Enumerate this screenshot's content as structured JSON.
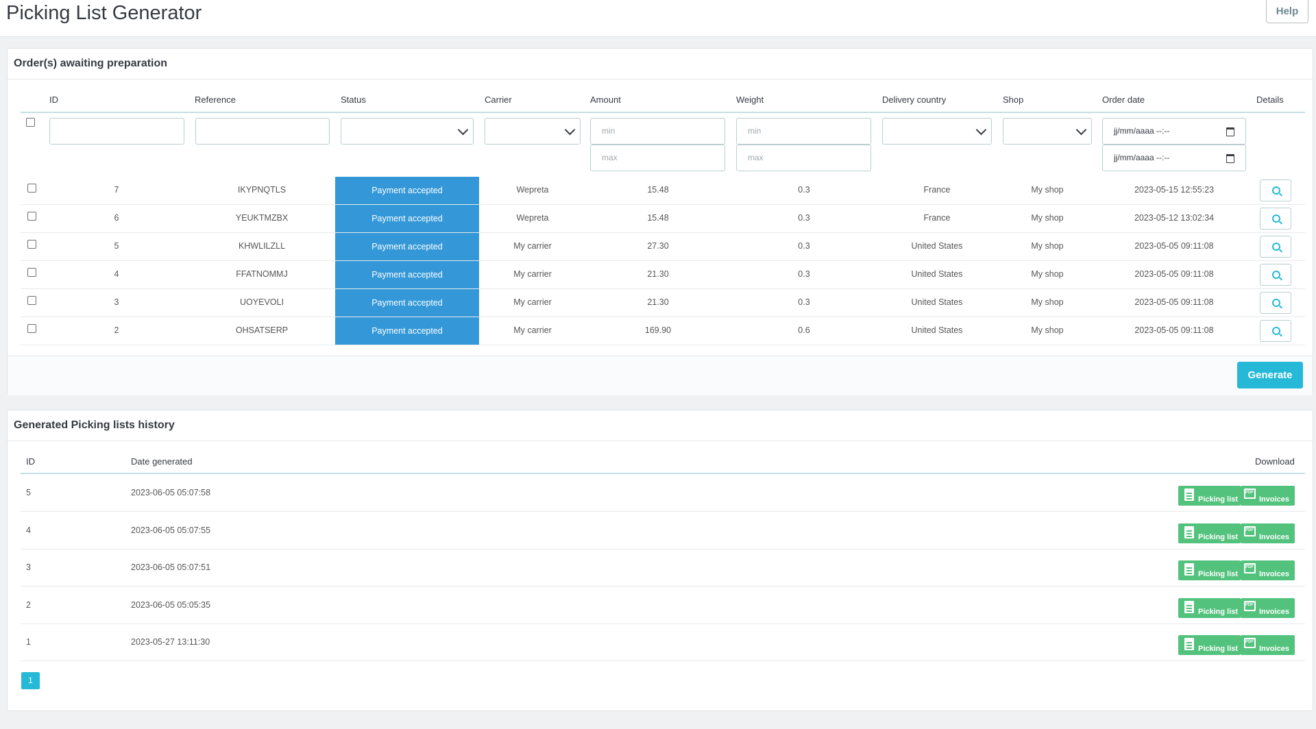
{
  "header": {
    "title": "Picking List Generator",
    "help_label": "Help"
  },
  "orders_panel": {
    "title": "Order(s) awaiting preparation",
    "columns": [
      "ID",
      "Reference",
      "Status",
      "Carrier",
      "Amount",
      "Weight",
      "Delivery country",
      "Shop",
      "Order date",
      "Details"
    ],
    "filters": {
      "amount_min_placeholder": "min",
      "amount_max_placeholder": "max",
      "weight_min_placeholder": "min",
      "weight_max_placeholder": "max",
      "date_from_placeholder": "jj/mm/aaaa --:--",
      "date_to_placeholder": "jj/mm/aaaa --:--"
    },
    "rows": [
      {
        "id": "7",
        "reference": "IKYPNQTLS",
        "status": "Payment accepted",
        "carrier": "Wepreta",
        "amount": "15.48",
        "weight": "0.3",
        "country": "France",
        "shop": "My shop",
        "date": "2023-05-15 12:55:23"
      },
      {
        "id": "6",
        "reference": "YEUKTMZBX",
        "status": "Payment accepted",
        "carrier": "Wepreta",
        "amount": "15.48",
        "weight": "0.3",
        "country": "France",
        "shop": "My shop",
        "date": "2023-05-12 13:02:34"
      },
      {
        "id": "5",
        "reference": "KHWLILZLL",
        "status": "Payment accepted",
        "carrier": "My carrier",
        "amount": "27.30",
        "weight": "0.3",
        "country": "United States",
        "shop": "My shop",
        "date": "2023-05-05 09:11:08"
      },
      {
        "id": "4",
        "reference": "FFATNOMMJ",
        "status": "Payment accepted",
        "carrier": "My carrier",
        "amount": "21.30",
        "weight": "0.3",
        "country": "United States",
        "shop": "My shop",
        "date": "2023-05-05 09:11:08"
      },
      {
        "id": "3",
        "reference": "UOYEVOLI",
        "status": "Payment accepted",
        "carrier": "My carrier",
        "amount": "21.30",
        "weight": "0.3",
        "country": "United States",
        "shop": "My shop",
        "date": "2023-05-05 09:11:08"
      },
      {
        "id": "2",
        "reference": "OHSATSERP",
        "status": "Payment accepted",
        "carrier": "My carrier",
        "amount": "169.90",
        "weight": "0.6",
        "country": "United States",
        "shop": "My shop",
        "date": "2023-05-05 09:11:08"
      }
    ],
    "generate_label": "Generate"
  },
  "history_panel": {
    "title": "Generated Picking lists history",
    "columns": [
      "ID",
      "Date generated",
      "Download"
    ],
    "rows": [
      {
        "id": "5",
        "date": "2023-06-05 05:07:58"
      },
      {
        "id": "4",
        "date": "2023-06-05 05:07:55"
      },
      {
        "id": "3",
        "date": "2023-06-05 05:07:51"
      },
      {
        "id": "2",
        "date": "2023-06-05 05:05:35"
      },
      {
        "id": "1",
        "date": "2023-05-27 13:11:30"
      }
    ],
    "picking_list_label": "Picking list",
    "invoices_label": "Invoices",
    "pagination": [
      "1"
    ]
  },
  "colors": {
    "accent": "#25b9d7",
    "status_blue": "#3498d8",
    "download_green": "#53c27c"
  },
  "icons": [
    "magnifier-icon",
    "document-icon",
    "pdf-icon",
    "calendar-icon",
    "chevron-down-icon"
  ]
}
